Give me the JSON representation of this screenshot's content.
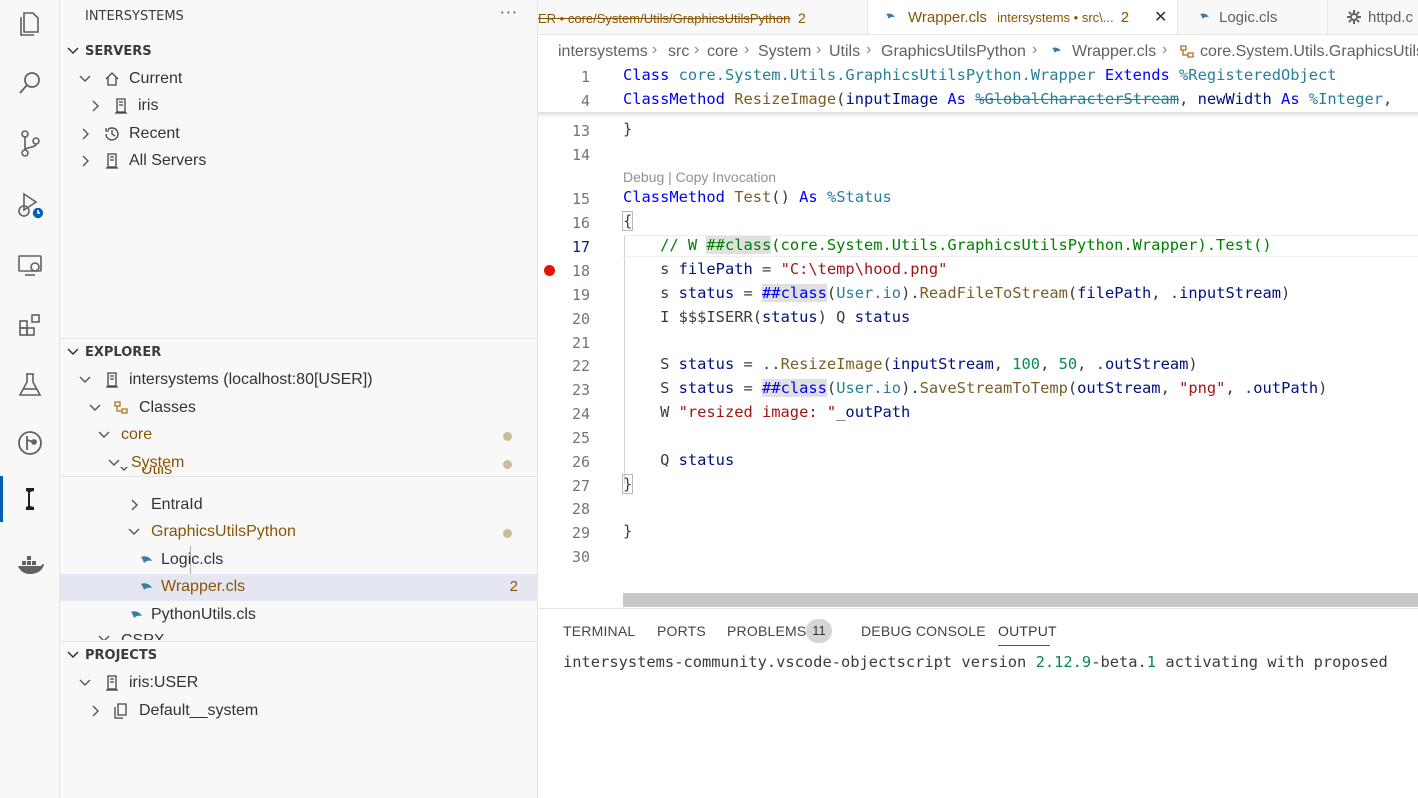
{
  "sidebar": {
    "title": "INTERSYSTEMS",
    "more": "···",
    "servers": {
      "header": "SERVERS",
      "current": "Current",
      "iris": "iris",
      "recent": "Recent",
      "all_servers": "All Servers"
    },
    "explorer": {
      "header": "EXPLORER",
      "root": "intersystems (localhost:80[USER])",
      "classes": "Classes",
      "core": "core",
      "system": "System",
      "utils": "Utils",
      "entraid": "EntraId",
      "graphics": "GraphicsUtilsPython",
      "logic": "Logic.cls",
      "wrapper": "Wrapper.cls",
      "wrapper_badge": "2",
      "pythonutils": "PythonUtils.cls",
      "cspx": "CSPX"
    },
    "projects": {
      "header": "PROJECTS",
      "iris_user": "iris:USER",
      "default_system": "Default__system"
    }
  },
  "tabs": {
    "tab1_label": "ER • core/System/Utils/GraphicsUtilsPython",
    "tab1_count": "2",
    "tab2_label": "Wrapper.cls",
    "tab2_desc": "intersystems • src\\...",
    "tab2_count": "2",
    "tab2_close": "✕",
    "tab3_label": "Logic.cls",
    "tab4_label": "httpd.c"
  },
  "breadcrumbs": [
    "intersystems",
    "src",
    "core",
    "System",
    "Utils",
    "GraphicsUtilsPython",
    "Wrapper.cls",
    "core.System.Utils.GraphicsUtils"
  ],
  "editor": {
    "line_numbers": [
      "1",
      "4",
      "13",
      "14",
      "15",
      "16",
      "17",
      "18",
      "19",
      "20",
      "21",
      "22",
      "23",
      "24",
      "25",
      "26",
      "27",
      "28",
      "29",
      "30"
    ],
    "codelens": "Debug | Copy Invocation",
    "code": {
      "l1_a": "Class",
      "l1_b": "core.System.Utils.GraphicsUtilsPython.Wrapper",
      "l1_c": "Extends",
      "l1_d": "%RegisteredObject",
      "l4_a": "ClassMethod",
      "l4_b": "ResizeImage",
      "l4_c": "(",
      "l4_d": "inputImage",
      "l4_e": "As",
      "l4_f": "%GlobalCharacterStream",
      "l4_g": ", ",
      "l4_h": "newWidth",
      "l4_i": "As",
      "l4_j": "%Integer",
      "l4_k": ",",
      "l13": "}",
      "l15_a": "ClassMethod",
      "l15_b": "Test",
      "l15_c": "() ",
      "l15_d": "As",
      "l15_e": "%Status",
      "l16": "{",
      "l17_a": "    // W ",
      "l17_b": "##class",
      "l17_c": "(core.System.Utils.GraphicsUtilsPython.Wrapper).Test()",
      "l18_a": "    s ",
      "l18_b": "filePath",
      "l18_c": " = ",
      "l18_d": "\"C:\\temp\\hood.png\"",
      "l19_a": "    s ",
      "l19_b": "status",
      "l19_c": " = ",
      "l19_d": "##class",
      "l19_e": "(",
      "l19_f": "User.io",
      "l19_g": ").",
      "l19_h": "ReadFileToStream",
      "l19_i": "(",
      "l19_j": "filePath",
      "l19_k": ", .",
      "l19_l": "inputStream",
      "l19_m": ")",
      "l20_a": "    I ",
      "l20_b": "$$$ISERR",
      "l20_c": "(",
      "l20_d": "status",
      "l20_e": ") Q ",
      "l20_f": "status",
      "l22_a": "    S ",
      "l22_b": "status",
      "l22_c": " = ..",
      "l22_d": "ResizeImage",
      "l22_e": "(",
      "l22_f": "inputStream",
      "l22_g": ", ",
      "l22_h": "100",
      "l22_i": ", ",
      "l22_j": "50",
      "l22_k": ", .",
      "l22_l": "outStream",
      "l22_m": ")",
      "l23_a": "    S ",
      "l23_b": "status",
      "l23_c": " = ",
      "l23_d": "##class",
      "l23_e": "(",
      "l23_f": "User.io",
      "l23_g": ").",
      "l23_h": "SaveStreamToTemp",
      "l23_i": "(",
      "l23_j": "outStream",
      "l23_k": ", ",
      "l23_l": "\"png\"",
      "l23_m": ", .",
      "l23_n": "outPath",
      "l23_o": ")",
      "l24_a": "    W ",
      "l24_b": "\"resized image: \"",
      "l24_c": "_",
      "l24_d": "outPath",
      "l26_a": "    Q ",
      "l26_b": "status",
      "l27": "}",
      "l29": "}"
    }
  },
  "panel": {
    "terminal": "TERMINAL",
    "ports": "PORTS",
    "problems": "PROBLEMS",
    "problems_count": "11",
    "debug_console": "DEBUG CONSOLE",
    "output": "OUTPUT",
    "output_a": "intersystems-community.vscode-objectscript version ",
    "output_b": "2.12.9",
    "output_c": "-beta.",
    "output_d": "1",
    "output_e": " activating with proposed"
  },
  "colors": {
    "accent": "#005fb8",
    "modified": "#895503",
    "breakpoint": "#e51400"
  },
  "icons": [
    "files-icon",
    "search-icon",
    "source-control-icon",
    "run-debug-icon",
    "remote-explorer-icon",
    "extensions-icon",
    "testing-icon",
    "gitlens-icon",
    "intersystems-icon",
    "docker-icon"
  ]
}
